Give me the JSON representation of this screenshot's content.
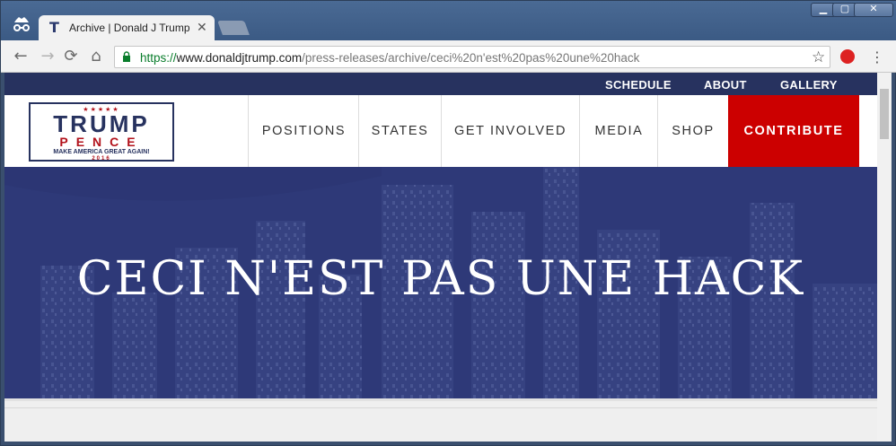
{
  "browser": {
    "tab_title": "Archive | Donald J Trump",
    "tab_close": "✕",
    "url_scheme": "https://",
    "url_host": "www.donaldjtrump.com",
    "url_path": "/press-releases/archive/ceci%20n'est%20pas%20une%20hack",
    "win_minimize": "▁",
    "win_maximize": "▢",
    "win_close": "✕",
    "back": "←",
    "forward": "→",
    "reload": "⟳",
    "home": "⌂",
    "star": "☆",
    "menu": "⋮"
  },
  "site": {
    "top_links": [
      "SCHEDULE",
      "ABOUT",
      "GALLERY"
    ],
    "logo": {
      "stars": "★★★★★",
      "line1": "TRUMP",
      "line2": "PENCE",
      "tagline": "MAKE AMERICA GREAT AGAIN!",
      "year": "2016"
    },
    "nav": [
      "POSITIONS",
      "STATES",
      "GET INVOLVED",
      "MEDIA",
      "SHOP",
      "CONTRIBUTE"
    ],
    "hero_title": "CECI N'EST PAS UNE HACK"
  },
  "colors": {
    "navy": "#27325f",
    "contribute_red": "#c00",
    "hero_blue": "#2e3a78"
  }
}
